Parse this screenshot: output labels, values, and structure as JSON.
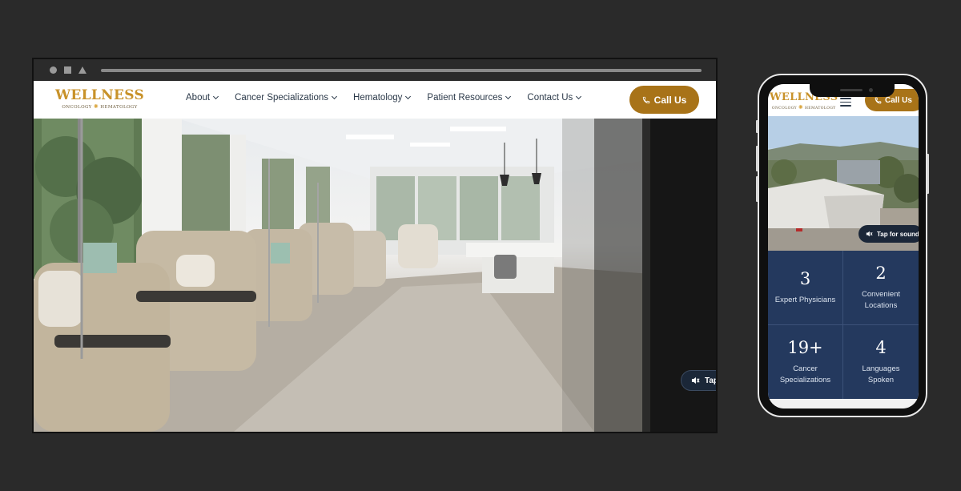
{
  "desktop": {
    "logo": {
      "word": "WELLNESS",
      "sub_left": "ONCOLOGY",
      "sub_right": "HEMATOLOGY"
    },
    "nav": [
      {
        "label": "About"
      },
      {
        "label": "Cancer Specializations"
      },
      {
        "label": "Hematology"
      },
      {
        "label": "Patient Resources"
      },
      {
        "label": "Contact Us"
      }
    ],
    "call_button": "Call Us",
    "sound_button": "Tap"
  },
  "mobile": {
    "logo": {
      "word": "WELLNESS",
      "sub_left": "ONCOLOGY",
      "sub_right": "HEMATOLOGY"
    },
    "call_button": "Call Us",
    "sound_button": "Tap for sound",
    "stats": [
      {
        "number": "3",
        "label": "Expert Physicians"
      },
      {
        "number": "2",
        "label": "Convenient Locations"
      },
      {
        "number": "19+",
        "label": "Cancer Specializations"
      },
      {
        "number": "4",
        "label": "Languages Spoken"
      }
    ]
  },
  "colors": {
    "brand_gold": "#a87318",
    "logo_gold": "#c8922a",
    "stats_navy": "#24395e",
    "backdrop": "#2a2a2a"
  },
  "icons": [
    "phone-icon",
    "speaker-icon",
    "menu-icon",
    "chevron-down-icon"
  ]
}
